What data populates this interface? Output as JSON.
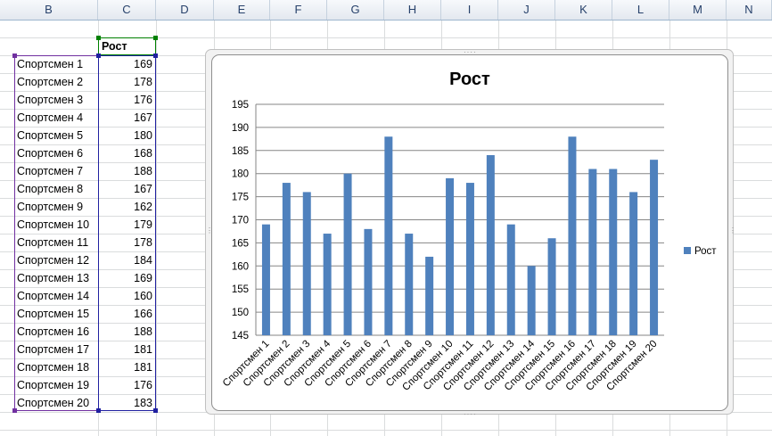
{
  "columns": [
    "B",
    "C",
    "D",
    "E",
    "F",
    "G",
    "H",
    "I",
    "J",
    "K",
    "L",
    "M",
    "N"
  ],
  "header_cell": "Рост",
  "rows": [
    {
      "name": "Спортсмен 1",
      "value": 169
    },
    {
      "name": "Спортсмен 2",
      "value": 178
    },
    {
      "name": "Спортсмен 3",
      "value": 176
    },
    {
      "name": "Спортсмен 4",
      "value": 167
    },
    {
      "name": "Спортсмен 5",
      "value": 180
    },
    {
      "name": "Спортсмен 6",
      "value": 168
    },
    {
      "name": "Спортсмен 7",
      "value": 188
    },
    {
      "name": "Спортсмен 8",
      "value": 167
    },
    {
      "name": "Спортсмен 9",
      "value": 162
    },
    {
      "name": "Спортсмен 10",
      "value": 179
    },
    {
      "name": "Спортсмен 11",
      "value": 178
    },
    {
      "name": "Спортсмен 12",
      "value": 184
    },
    {
      "name": "Спортсмен 13",
      "value": 169
    },
    {
      "name": "Спортсмен 14",
      "value": 160
    },
    {
      "name": "Спортсмен 15",
      "value": 166
    },
    {
      "name": "Спортсмен 16",
      "value": 188
    },
    {
      "name": "Спортсмен 17",
      "value": 181
    },
    {
      "name": "Спортсмен 18",
      "value": 181
    },
    {
      "name": "Спортсмен 19",
      "value": 176
    },
    {
      "name": "Спортсмен 20",
      "value": 183
    }
  ],
  "colors": {
    "bar": "#4f81bd",
    "name_range_border": "#7030a0",
    "value_range_border": "#2020a0",
    "header_range_border": "#008000",
    "gridline": "#868686"
  },
  "chart_data": {
    "type": "bar",
    "title": "Рост",
    "categories": [
      "Спортсмен 1",
      "Спортсмен 2",
      "Спортсмен 3",
      "Спортсмен 4",
      "Спортсмен 5",
      "Спортсмен 6",
      "Спортсмен 7",
      "Спортсмен 8",
      "Спортсмен 9",
      "Спортсмен 10",
      "Спортсмен 11",
      "Спортсмен 12",
      "Спортсмен 13",
      "Спортсмен 14",
      "Спортсмен 15",
      "Спортсмен 16",
      "Спортсмен 17",
      "Спортсмен 18",
      "Спортсмен 19",
      "Спортсмен 20"
    ],
    "series": [
      {
        "name": "Рост",
        "values": [
          169,
          178,
          176,
          167,
          180,
          168,
          188,
          167,
          162,
          179,
          178,
          184,
          169,
          160,
          166,
          188,
          181,
          181,
          176,
          183
        ]
      }
    ],
    "ylim": [
      145,
      195
    ],
    "yticks": [
      145,
      150,
      155,
      160,
      165,
      170,
      175,
      180,
      185,
      190,
      195
    ],
    "xlabel": "",
    "ylabel": "",
    "grid": true,
    "legend": "right"
  }
}
